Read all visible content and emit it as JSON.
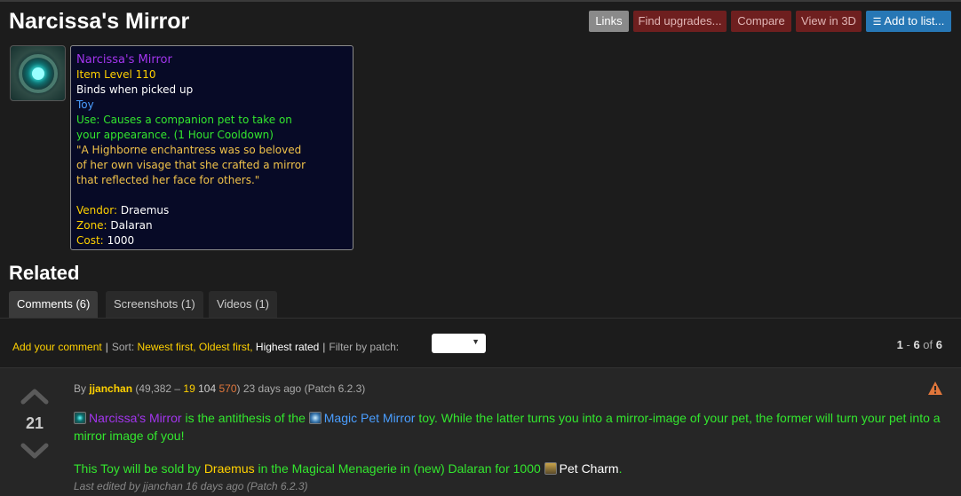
{
  "page": {
    "title": "Narcissa's Mirror"
  },
  "actions": {
    "links": "Links",
    "find_upgrades": "Find upgrades...",
    "compare": "Compare",
    "view_3d": "View in 3D",
    "add_to_list": "Add to list..."
  },
  "item_icon": "mirror-item-icon",
  "tooltip": {
    "name": "Narcissa's Mirror",
    "item_level": "Item Level 110",
    "binds": "Binds when picked up",
    "type": "Toy",
    "use_line1": "Use: Causes a companion pet to take on",
    "use_line2": "your appearance. (1 Hour Cooldown)",
    "flavor_line1": "\"A Highborne enchantress was so beloved",
    "flavor_line2": "of her own visage that she crafted a mirror",
    "flavor_line3": "that reflected her face for others.\"",
    "vendor_label": "Vendor:",
    "vendor_value": "Draemus",
    "zone_label": "Zone:",
    "zone_value": "Dalaran",
    "cost_label": "Cost:",
    "cost_value": "1000"
  },
  "related": {
    "heading": "Related",
    "tabs": [
      {
        "label": "Comments (6)",
        "active": true
      },
      {
        "label": "Screenshots (1)",
        "active": false
      },
      {
        "label": "Videos (1)",
        "active": false
      }
    ]
  },
  "toolbar": {
    "add_comment": "Add your comment",
    "sort_label": "Sort:",
    "sort_newest": "Newest first,",
    "sort_oldest": "Oldest first,",
    "sort_highest": "Highest rated",
    "filter_label": "Filter by patch:",
    "filter_value": ""
  },
  "pager": {
    "start": "1",
    "dash": " - ",
    "end": "6",
    "of": " of ",
    "total": "6"
  },
  "comment": {
    "score": "21",
    "by": "By",
    "author": "jjanchan",
    "rep_open": " (49,382 – ",
    "rep_gold": "19",
    "rep_silver": " 104 ",
    "rep_bronze": "570",
    "rep_close": ")",
    "time": " 23 days ago (Patch 6.2.3)",
    "p1_item1": "Narcissa's Mirror",
    "p1_t1": " is the antithesis of the ",
    "p1_item2": "Magic Pet Mirror",
    "p1_t2": " toy. While the latter turns you into a mirror-image of your pet, the former will turn your pet into a mirror image of you!",
    "p2_t1": "This Toy will be sold by ",
    "p2_npc": "Draemus",
    "p2_t2": " in the Magical Menagerie in (new) Dalaran for 1000 ",
    "p2_currency": "Pet Charm",
    "p2_t3": ".",
    "edited": "Last edited by jjanchan 16 days ago (Patch 6.2.3)"
  },
  "colors": {
    "epic": "#a335ee",
    "gold": "#ffd100",
    "green": "#33e62e",
    "blue": "#4a9eff",
    "button_red": "#6e1f1f",
    "button_blue": "#2777b5"
  }
}
